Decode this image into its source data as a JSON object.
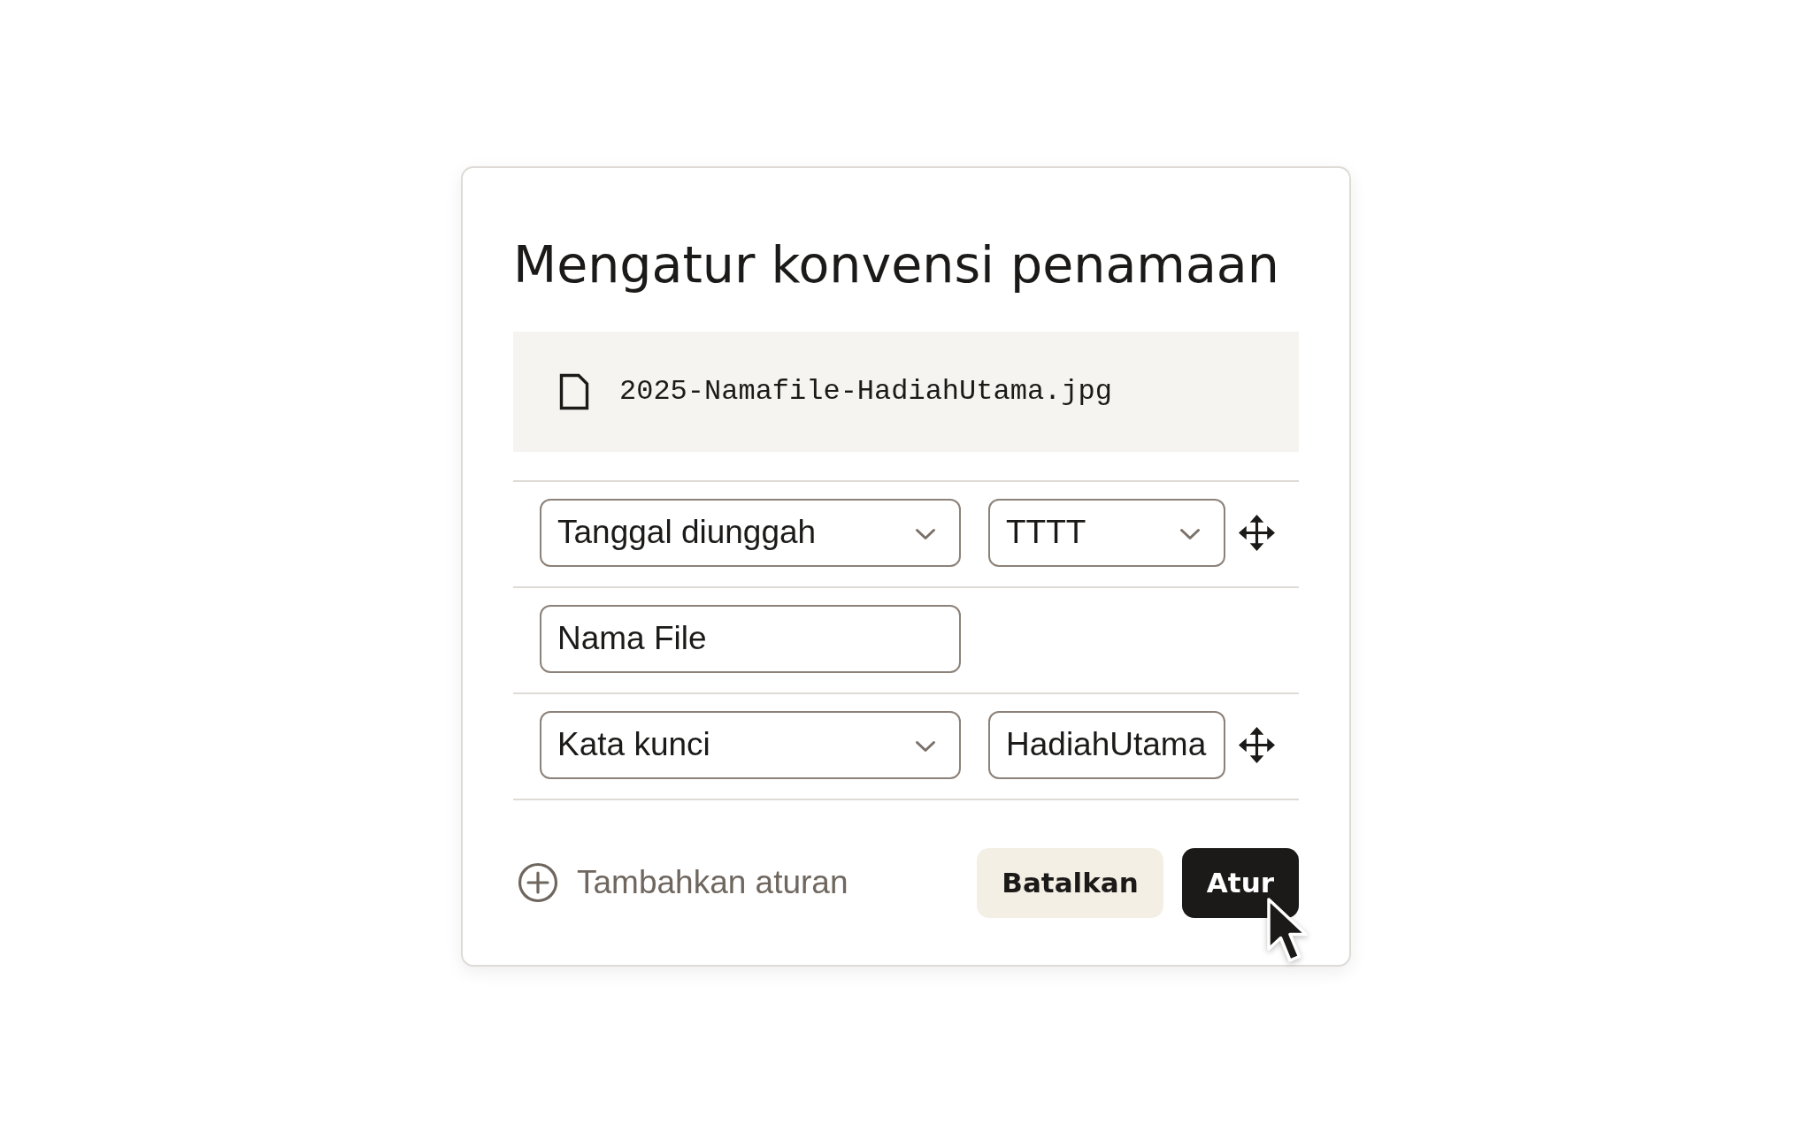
{
  "dialog": {
    "title": "Mengatur konvensi penamaan",
    "preview": {
      "filename": "2025-Namafile-HadiahUtama.jpg"
    },
    "rules": [
      {
        "controls": [
          {
            "kind": "select",
            "value": "Tanggal diunggah"
          },
          {
            "kind": "select",
            "value": "TTTT"
          }
        ],
        "movable": true
      },
      {
        "controls": [
          {
            "kind": "text",
            "value": "Nama File"
          }
        ],
        "movable": false
      },
      {
        "controls": [
          {
            "kind": "select",
            "value": "Kata kunci"
          },
          {
            "kind": "text",
            "value": "HadiahUtama"
          }
        ],
        "movable": true
      }
    ],
    "add_rule": {
      "label": "Tambahkan aturan"
    },
    "buttons": [
      {
        "kind": "secondary",
        "label": "Batalkan"
      },
      {
        "kind": "primary",
        "label": "Atur"
      }
    ]
  }
}
